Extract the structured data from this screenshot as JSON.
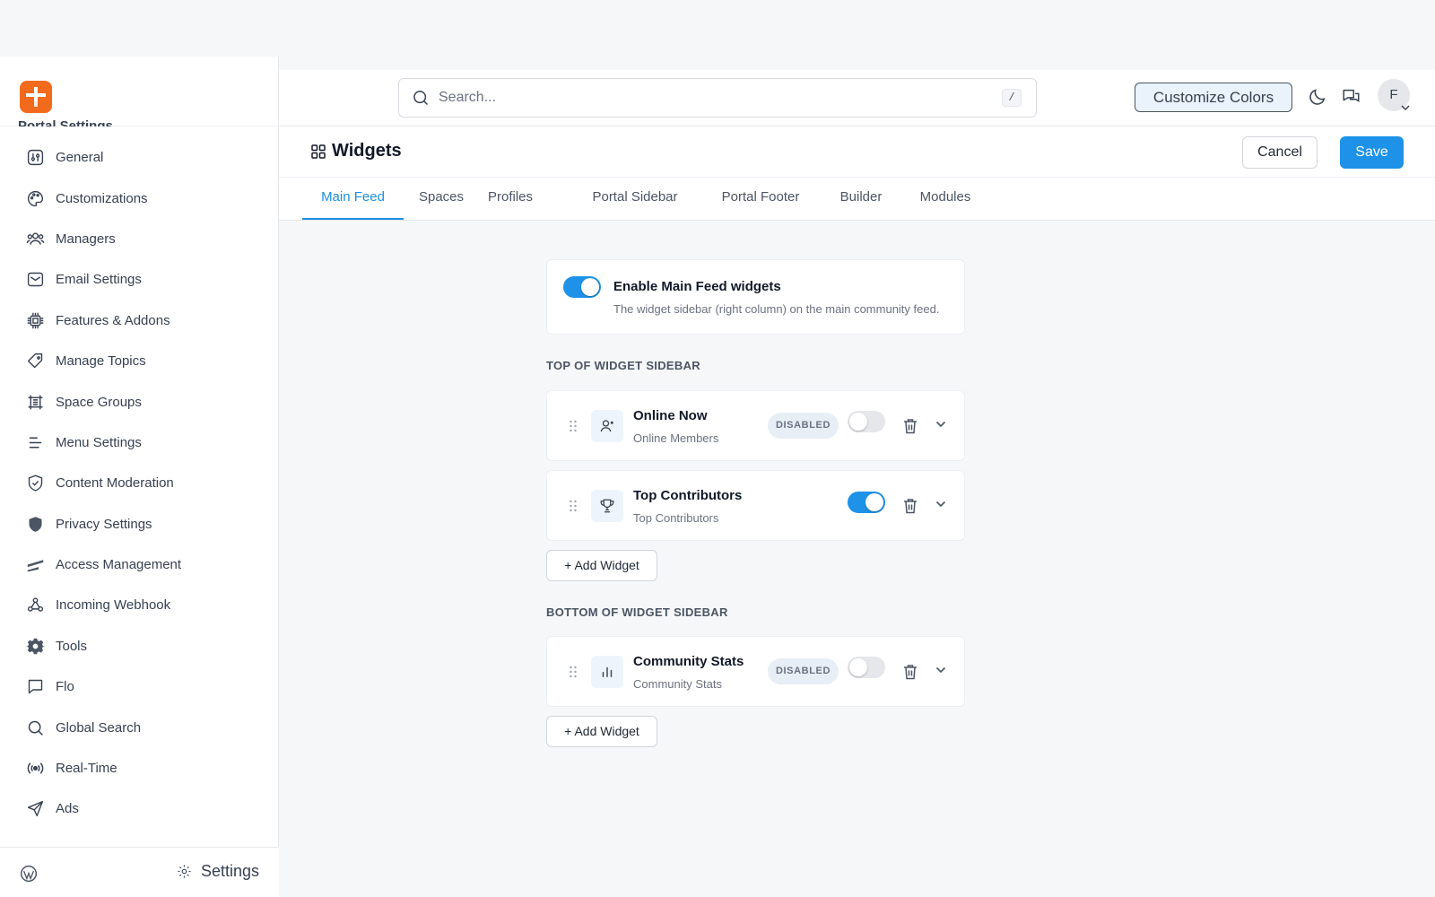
{
  "brand": {
    "accent": "#1d92e8",
    "logo_color": "#f26b1d"
  },
  "sidebar": {
    "section_title": "Portal Settings",
    "items": [
      {
        "label": "General",
        "icon": "sliders-icon"
      },
      {
        "label": "Customizations",
        "icon": "palette-icon"
      },
      {
        "label": "Managers",
        "icon": "users-icon"
      },
      {
        "label": "Email Settings",
        "icon": "mail-icon"
      },
      {
        "label": "Features & Addons",
        "icon": "chip-icon"
      },
      {
        "label": "Manage Topics",
        "icon": "tag-icon"
      },
      {
        "label": "Space Groups",
        "icon": "frame-icon"
      },
      {
        "label": "Menu Settings",
        "icon": "menu-icon"
      },
      {
        "label": "Content Moderation",
        "icon": "shield-check-icon"
      },
      {
        "label": "Privacy Settings",
        "icon": "shield-icon"
      },
      {
        "label": "Access Management",
        "icon": "stripes-icon"
      },
      {
        "label": "Incoming Webhook",
        "icon": "webhook-icon"
      },
      {
        "label": "Tools",
        "icon": "gear-icon"
      },
      {
        "label": "Flo",
        "icon": "chat-icon"
      },
      {
        "label": "Global Search",
        "icon": "search-icon"
      },
      {
        "label": "Real-Time",
        "icon": "broadcast-icon"
      },
      {
        "label": "Ads",
        "icon": "send-icon"
      }
    ],
    "footer_label": "Settings"
  },
  "header": {
    "search_placeholder": "Search...",
    "search_shortcut": "/",
    "customize_label": "Customize Colors",
    "avatar_initial": "F"
  },
  "page": {
    "title": "Widgets",
    "cancel_label": "Cancel",
    "save_label": "Save",
    "tabs": [
      {
        "label": "Main Feed",
        "active": true
      },
      {
        "label": "Spaces"
      },
      {
        "label": "Profiles"
      },
      {
        "label": "Portal Sidebar"
      },
      {
        "label": "Portal Footer"
      },
      {
        "label": "Builder"
      },
      {
        "label": "Modules"
      }
    ]
  },
  "main_feed": {
    "enable_title": "Enable Main Feed widgets",
    "enable_desc": "The widget sidebar (right column) on the main community feed.",
    "enabled": true,
    "top_section_label": "TOP OF WIDGET SIDEBAR",
    "bottom_section_label": "BOTTOM OF WIDGET SIDEBAR",
    "add_widget_label": "+ Add Widget",
    "top_widgets": [
      {
        "title": "Online Now",
        "subtitle": "Online Members",
        "badge": "DISABLED",
        "enabled": false,
        "icon": "user-online-icon"
      },
      {
        "title": "Top Contributors",
        "subtitle": "Top Contributors",
        "enabled": true,
        "icon": "trophy-icon"
      }
    ],
    "bottom_widgets": [
      {
        "title": "Community Stats",
        "subtitle": "Community Stats",
        "badge": "DISABLED",
        "enabled": false,
        "icon": "bar-chart-icon"
      }
    ]
  }
}
